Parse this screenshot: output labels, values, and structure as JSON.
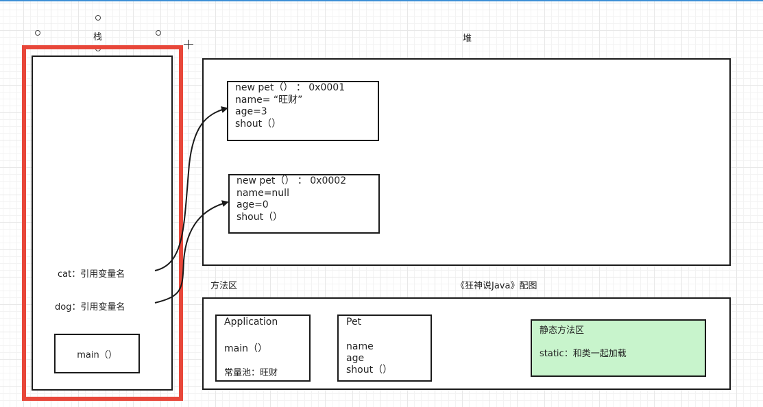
{
  "labels": {
    "stack": "栈",
    "heap": "堆",
    "method_area": "方法区",
    "caption": "《狂神说Java》配图"
  },
  "stack": {
    "cat": "cat：引用变量名",
    "dog": "dog：引用变量名",
    "main": "main（）"
  },
  "heap": {
    "obj1": {
      "header": "new pet（）  ：  0x0001",
      "name": "name= “旺财”",
      "age": "age=3",
      "shout": "shout（）"
    },
    "obj2": {
      "header": "new pet（）  ：  0x0002",
      "name": "name=null",
      "age": "age=0",
      "shout": "shout（）"
    }
  },
  "method_area": {
    "application": {
      "title": "Application",
      "main": "main（）",
      "pool": "常量池：旺财"
    },
    "pet": {
      "title": "Pet",
      "name": "name",
      "age": "age",
      "shout": "shout（）"
    },
    "static_area": {
      "title": "静态方法区",
      "desc": "static：和类一起加载"
    }
  },
  "colors": {
    "highlight": "#e8473a",
    "static_fill": "#c8f4cc",
    "line": "#1a1a1a"
  }
}
